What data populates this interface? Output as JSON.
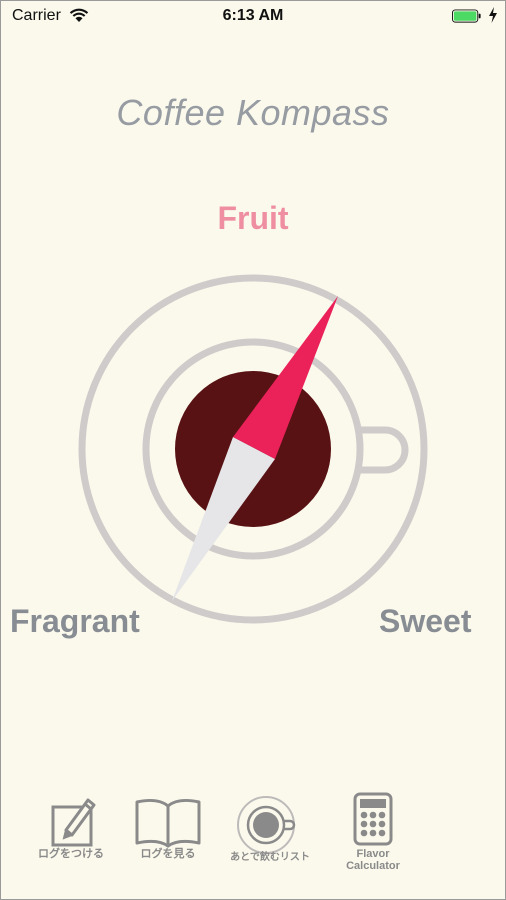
{
  "status_bar": {
    "carrier": "Carrier",
    "time": "6:13 AM"
  },
  "app": {
    "title": "Coffee Kompass"
  },
  "compass": {
    "top_label": "Fruit",
    "left_label": "Fragrant",
    "right_label": "Sweet",
    "needle_color": "#eb2159",
    "tail_color": "#e6e6e8",
    "coffee_color": "#581214",
    "ring_color": "#cfcbca"
  },
  "tabs": [
    {
      "label": "ログをつける",
      "icon": "pencil-note-icon"
    },
    {
      "label": "ログを見る",
      "icon": "open-book-icon"
    },
    {
      "label": "あとで飲むリスト",
      "icon": "coffee-cup-icon"
    },
    {
      "label": "Flavor\nCalculator",
      "icon": "calculator-icon"
    }
  ],
  "colors": {
    "background": "#fbf9ec",
    "battery": "#4cd964"
  }
}
